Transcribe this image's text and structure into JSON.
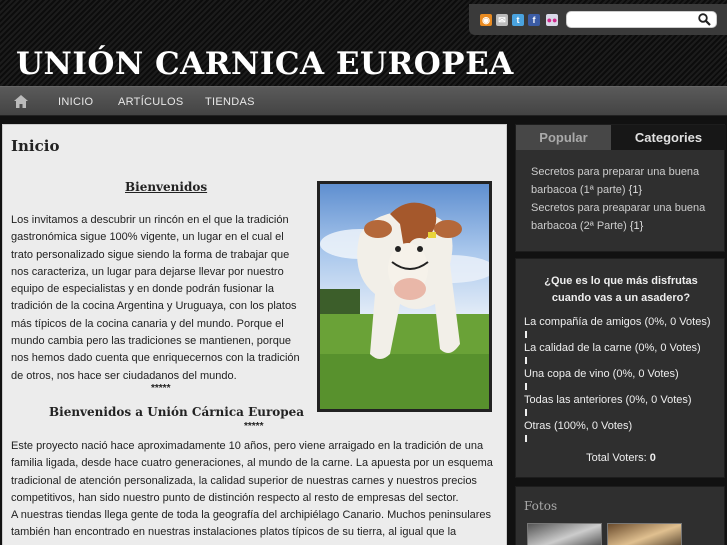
{
  "site": {
    "title": "UNIÓN CARNICA EUROPEA"
  },
  "social": {
    "icons": [
      "rss-icon",
      "mail-icon",
      "twitter-icon",
      "facebook-icon",
      "flickr-icon"
    ]
  },
  "search": {
    "placeholder": ""
  },
  "nav": {
    "items": [
      {
        "label": "INICIO"
      },
      {
        "label": "ARTÍCULOS"
      },
      {
        "label": "TIENDAS"
      }
    ]
  },
  "main": {
    "title": "Inicio",
    "welcome": "Bienvenidos",
    "intro": "Los invitamos a descubrir un rincón en el que la tradición gastronómica sigue 100% vigente, un lugar en el cual el trato personalizado sigue siendo la forma de trabajar que nos caracteriza, un lugar para dejarse llevar por nuestro equipo de especialistas y en donde podrán fusionar la tradición de la cocina Argentina y Uruguaya, con los platos más típicos de la cocina canaria y del mundo. Porque el mundo cambia pero las tradiciones se mantienen, porque nos hemos dado cuenta que enriquecernos con la tradición de otros, nos hace ser ciudadanos del mundo.",
    "stars": "*****",
    "welcome2": "Bienvenidos a Unión Cárnica Europea",
    "body": [
      "Este proyecto nació hace aproximadamente 10 años, pero viene arraigado en la tradición de una familia ligada, desde hace cuatro generaciones, al mundo de la carne. La apuesta por un esquema tradicional de atención personalizada, la calidad superior de nuestras carnes y nuestros precios competitivos, han sido nuestro punto de distinción respecto al resto de empresas del sector.",
      "A nuestras tiendas llega gente de toda la geografía del archipiélago Canario. Muchos peninsulares también han encontrado en nuestras instalaciones platos típicos de su tierra, al igual que la colectividad"
    ]
  },
  "sidebar": {
    "tabs": [
      {
        "label": "Popular"
      },
      {
        "label": "Categories"
      }
    ],
    "posts": [
      {
        "title": "Secretos para preparar una buena barbacoa (1ª parte)",
        "count": "{1}"
      },
      {
        "title": "Secretos para preaparar una buena barbacoa (2ª Parte)",
        "count": "{1}"
      }
    ],
    "poll": {
      "question": "¿Que es lo que más disfrutas cuando vas a un asadero?",
      "options": [
        {
          "label": "La compañía de amigos (0%, 0 Votes)",
          "percent": 0
        },
        {
          "label": "La calidad de la carne (0%, 0 Votes)",
          "percent": 0
        },
        {
          "label": "Una copa de vino (0%, 0 Votes)",
          "percent": 0
        },
        {
          "label": "Todas las anteriores (0%, 0 Votes)",
          "percent": 0
        },
        {
          "label": "Otras (100%, 0 Votes)",
          "percent": 100
        }
      ],
      "total_label": "Total Voters:",
      "total_value": "0"
    },
    "fotos_title": "Fotos"
  }
}
